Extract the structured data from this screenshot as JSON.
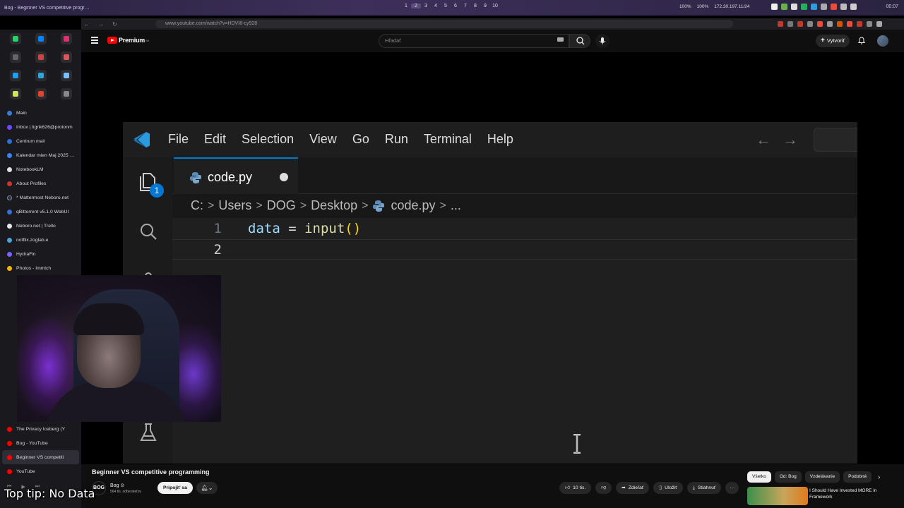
{
  "osbar": {
    "window_title": "Bog - Beginner VS competitive progr…",
    "workspaces": [
      "1",
      "2",
      "3",
      "4",
      "5",
      "6",
      "7",
      "8",
      "9",
      "10"
    ],
    "stats": [
      "100%",
      "100%",
      "172.30.197.11/24"
    ],
    "clock": "00:07"
  },
  "browser": {
    "url": "www.youtube.com/watch?v=HDVI8-cy928",
    "sidebar": {
      "items": [
        {
          "label": "Main",
          "color": "#3a7bd5"
        },
        {
          "label": "Inbox | tigrik626@protonm",
          "color": "#6d4aff"
        },
        {
          "label": "Centrum mail",
          "color": "#2a6fdb"
        },
        {
          "label": "Kalendar mien Maj 2025 …",
          "color": "#3b82f6"
        },
        {
          "label": "NotebookLM",
          "color": "#e0e0e0"
        },
        {
          "label": "About Profiles",
          "color": "#cc3333"
        },
        {
          "label": "* Mattermost Neboro.net",
          "color": "#1e325c"
        },
        {
          "label": "qBittorrent v5.1.0 WebUI",
          "color": "#3c6fd1"
        },
        {
          "label": "Neboro.net | Trello",
          "color": "#e8e8e8"
        },
        {
          "label": "notflix.zoglab.e",
          "color": "#4aa3df"
        },
        {
          "label": "HydraFin",
          "color": "#7b61ff"
        },
        {
          "label": "Photos - Immich",
          "color": "#f4b400"
        }
      ],
      "lower_items": [
        {
          "label": "The Privacy Iceberg (Y",
          "color": "#ff0000"
        },
        {
          "label": "Bog - YouTube",
          "color": "#ff0000"
        },
        {
          "label": "Beginner VS competiti",
          "color": "#ff0000"
        },
        {
          "label": "YouTube",
          "color": "#ff0000"
        }
      ]
    }
  },
  "youtube": {
    "logo_text": "Premium",
    "logo_sup": "SK",
    "search_placeholder": "Hľadať",
    "create_label": "Vytvoriť",
    "video": {
      "title": "Beginner VS competitive programming",
      "channel_initials": "BOG",
      "channel_name": "Bog ⊙",
      "channel_subs": "564 tis. odberateľov",
      "join_label": "Pripojiť sa",
      "likes": "10 tis.",
      "share_label": "Zdieľať",
      "save_label": "Uložiť",
      "download_label": "Stiahnuť",
      "more_label": "···"
    },
    "chips": [
      "Všetko",
      "Od: Bog",
      "Vzdelávanie",
      "Podobné"
    ],
    "recommendation_title": "I Should Have Invested MORE in Framework"
  },
  "vscode": {
    "menus": [
      "File",
      "Edit",
      "Selection",
      "View",
      "Go",
      "Run",
      "Terminal",
      "Help"
    ],
    "explorer_badge": "1",
    "tab_name": "code.py",
    "breadcrumb": [
      "C:",
      "Users",
      "DOG",
      "Desktop",
      "code.py",
      "..."
    ],
    "lines": [
      {
        "num": "1",
        "var": "data",
        "op": " = ",
        "fn": "input",
        "br": "()"
      },
      {
        "num": "2"
      }
    ]
  },
  "overlay": {
    "tip": "Top tip: No Data"
  }
}
